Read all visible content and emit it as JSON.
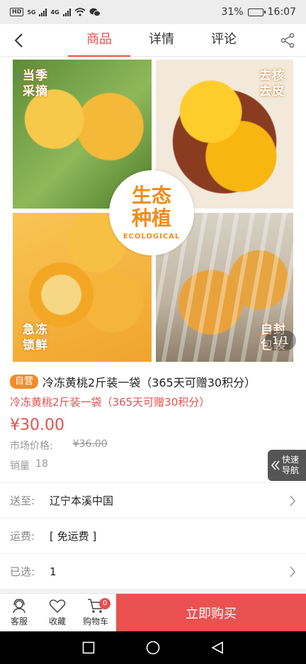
{
  "status_bar": {
    "badge": "HD",
    "network_1": "5G",
    "network_2": "4G",
    "battery": "31%",
    "time": "16:07",
    "battery_level": 0.31
  },
  "nav": {
    "tabs": [
      {
        "label": "商品",
        "active": true
      },
      {
        "label": "详情",
        "active": false
      },
      {
        "label": "评论",
        "active": false
      }
    ]
  },
  "hero": {
    "tags": [
      "当季采摘",
      "去核去皮",
      "急冻锁鲜",
      "自封包装"
    ],
    "badge_main": "生态种植",
    "badge_sub": "ECOLOGICAL",
    "pager": "1/1"
  },
  "product": {
    "self_badge": "自营",
    "title": "冷冻黄桃2斤装一袋（365天可赠30积分）",
    "subtitle": "冷冻黄桃2斤装一袋（365天可赠30积分）",
    "price": "¥30.00",
    "market_label": "市场价格:",
    "market_price": "¥36.00",
    "sales_label": "销量",
    "sales_value": "18"
  },
  "quick_nav": {
    "label": "快速导航"
  },
  "rows": {
    "delivery": {
      "label": "送至:",
      "value": "辽宁本溪中国"
    },
    "shipping": {
      "label": "运费:",
      "value": "[ 免运费 ]"
    },
    "selected": {
      "label": "已选:",
      "value": "1"
    }
  },
  "bottom_bar": {
    "service": "客服",
    "favorite": "收藏",
    "cart": "购物车",
    "cart_count": "0",
    "buy": "立即购买"
  },
  "colors": {
    "accent": "#e94e4e",
    "orange": "#f28c2b"
  }
}
